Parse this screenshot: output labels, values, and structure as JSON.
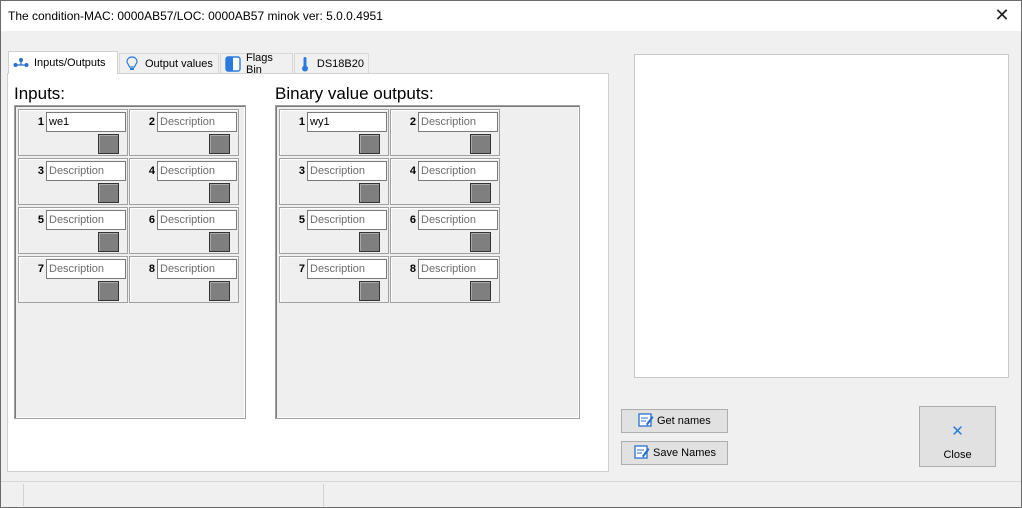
{
  "window": {
    "title": "The condition-MAC: 0000AB57/LOC: 0000AB57 minok ver: 5.0.0.4951"
  },
  "tabs": [
    {
      "label": "Inputs/Outputs",
      "icon": "network-icon",
      "active": true
    },
    {
      "label": "Output values",
      "icon": "lightbulb-icon",
      "active": false
    },
    {
      "label": "Flags Bin",
      "icon": "flag-panel-icon",
      "active": false
    },
    {
      "label": "DS18B20",
      "icon": "thermometer-icon",
      "active": false
    }
  ],
  "inputs": {
    "title": "Inputs:",
    "cells": [
      {
        "num": "1",
        "value": "we1",
        "placeholder": "Description"
      },
      {
        "num": "2",
        "value": "",
        "placeholder": "Description"
      },
      {
        "num": "3",
        "value": "",
        "placeholder": "Description"
      },
      {
        "num": "4",
        "value": "",
        "placeholder": "Description"
      },
      {
        "num": "5",
        "value": "",
        "placeholder": "Description"
      },
      {
        "num": "6",
        "value": "",
        "placeholder": "Description"
      },
      {
        "num": "7",
        "value": "",
        "placeholder": "Description"
      },
      {
        "num": "8",
        "value": "",
        "placeholder": "Description"
      }
    ]
  },
  "outputs": {
    "title": "Binary value outputs:",
    "cells": [
      {
        "num": "1",
        "value": "wy1",
        "placeholder": "Description"
      },
      {
        "num": "2",
        "value": "",
        "placeholder": "Description"
      },
      {
        "num": "3",
        "value": "",
        "placeholder": "Description"
      },
      {
        "num": "4",
        "value": "",
        "placeholder": "Description"
      },
      {
        "num": "5",
        "value": "",
        "placeholder": "Description"
      },
      {
        "num": "6",
        "value": "",
        "placeholder": "Description"
      },
      {
        "num": "7",
        "value": "",
        "placeholder": "Description"
      },
      {
        "num": "8",
        "value": "",
        "placeholder": "Description"
      }
    ]
  },
  "buttons": {
    "get_names": "Get names",
    "save_names": "Save Names",
    "close": "Close"
  },
  "colors": {
    "led_off": "#7f7f7f",
    "close_accent": "#2a7be0"
  }
}
